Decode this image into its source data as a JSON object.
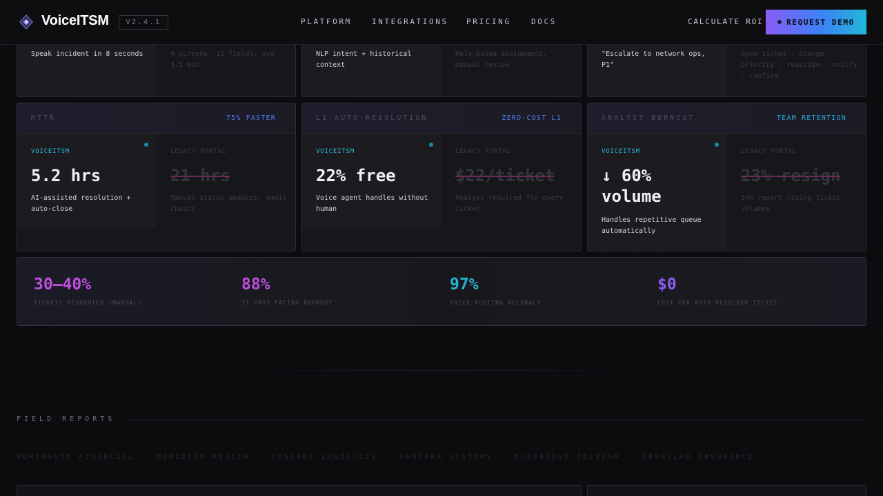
{
  "header": {
    "brand": "VoiceITSM",
    "version": "V2.4.1",
    "nav": [
      "PLATFORM",
      "INTEGRATIONS",
      "PRICING",
      "DOCS"
    ],
    "calculate_roi": "CALCULATE ROI",
    "request_demo": "REQUEST DEMO"
  },
  "top_cards": [
    {
      "voice": "Speak incident in 8 seconds",
      "legacy": "4 screens, 12 fields, avg 3.5 min"
    },
    {
      "voice": "NLP intent + historical context",
      "legacy": "Rule-based assignment, manual review"
    },
    {
      "voice": "\"Escalate to network ops, P1\"",
      "legacy": "Open ticket . change priority . reassign . notify . confirm"
    }
  ],
  "cards": [
    {
      "metric": "MTTR",
      "tag": "75% FASTER",
      "tag_color": "#4f7cf0",
      "voice_label": "VOICEITSM",
      "voice_value": "5.2 hrs",
      "voice_desc": "AI-assisted resolution + auto-close",
      "legacy_label": "LEGACY PORTAL",
      "legacy_value": "21 hrs",
      "legacy_desc": "Manual status updates, email chains"
    },
    {
      "metric": "L1 AUTO-RESOLUTION",
      "tag": "ZERO-COST L1",
      "tag_color": "#4f7cf0",
      "voice_label": "VOICEITSM",
      "voice_value": "22% free",
      "voice_desc": "Voice agent handles without human",
      "legacy_label": "LEGACY PORTAL",
      "legacy_value": "$22/ticket",
      "legacy_desc": "Analyst required for every ticket"
    },
    {
      "metric": "ANALYST BURNOUT",
      "tag": "TEAM RETENTION",
      "tag_color": "#2ba8d8",
      "voice_label": "VOICEITSM",
      "voice_value": "↓ 60% volume",
      "voice_desc": "Handles repetitive queue automatically",
      "legacy_label": "LEGACY PORTAL",
      "legacy_value": "23% resign",
      "legacy_desc": "34% report rising ticket volumes"
    }
  ],
  "stats": [
    {
      "value": "30–40%",
      "label": "TICKETS MISROUTED (MANUAL)",
      "color": "#c14ee0"
    },
    {
      "value": "88%",
      "label": "IT PROS FACING BURNOUT",
      "color": "#c14ee0"
    },
    {
      "value": "97%",
      "label": "VOICE ROUTING ACCURACY",
      "color": "#27b4d2"
    },
    {
      "value": "$0",
      "label": "COST PER AUTO-RESOLVED TICKET",
      "color": "#8a5cf0"
    }
  ],
  "field_reports": {
    "title": "FIELD REPORTS",
    "clients": [
      "NORTHGATE FINANCIAL",
      "MERIDIAN HEALTH",
      "CASCADE LOGISTICS",
      "VANTARA SYSTEMS",
      "BLUERIDGE TELECOM",
      "IRONCLAD INSURANCE"
    ]
  }
}
